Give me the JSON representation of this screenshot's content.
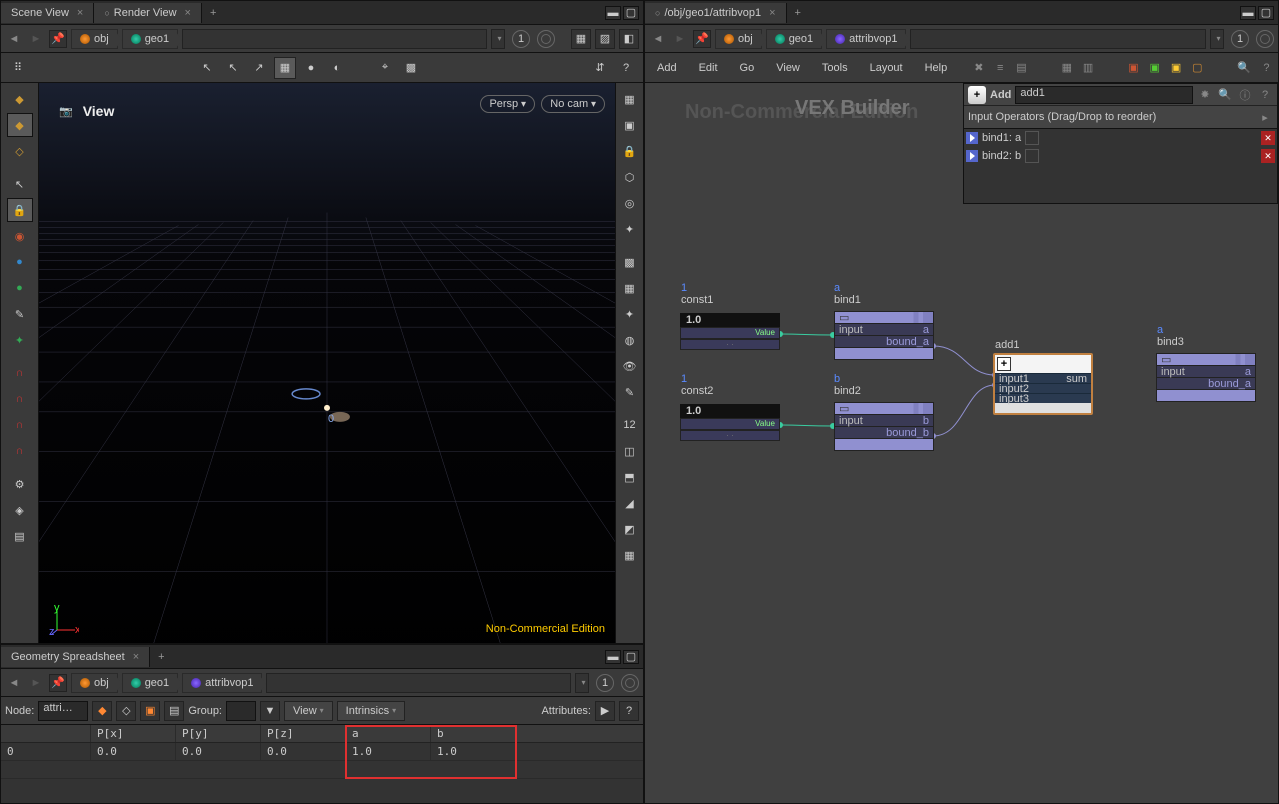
{
  "left_tabs": [
    "Scene View",
    "Render View"
  ],
  "right_tab": "/obj/geo1/attribvop1",
  "breadcrumbs": {
    "obj": "obj",
    "geo1": "geo1",
    "attribvop1": "attribvop1"
  },
  "circle_num": "1",
  "viewport": {
    "label": "View",
    "persp": "Persp",
    "nocam": "No cam",
    "nce": "Non-Commercial Edition",
    "ghost_nce": "Non-Commercial Edition"
  },
  "ne_menu": [
    "Add",
    "Edit",
    "Go",
    "View",
    "Tools",
    "Layout",
    "Help"
  ],
  "vex_label": "VEX Builder",
  "param": {
    "add_btn": "Add",
    "name": "add1",
    "inputs_header": "Input Operators (Drag/Drop to reorder)",
    "inputs": [
      "bind1: a",
      "bind2: b"
    ]
  },
  "nodes": {
    "const1": {
      "idx": "1",
      "name": "const1",
      "value": "1.0",
      "out": "Value"
    },
    "const2": {
      "idx": "1",
      "name": "const2",
      "value": "1.0",
      "out": "Value"
    },
    "bind1": {
      "idx": "a",
      "name": "bind1",
      "in": "input",
      "out": "bound_a"
    },
    "bind2": {
      "idx": "b",
      "name": "bind2",
      "in": "input",
      "out": "bound_b"
    },
    "add1": {
      "name": "add1",
      "ins": [
        "input1",
        "input2",
        "input3"
      ],
      "out": "sum"
    },
    "bind3": {
      "idx": "a",
      "name": "bind3",
      "in": "input",
      "out": "bound_a"
    }
  },
  "spreadsheet": {
    "tab": "Geometry Spreadsheet",
    "node_lbl": "Node:",
    "node_val": "attri…",
    "group_lbl": "Group:",
    "view_lbl": "View",
    "intrinsics_lbl": "Intrinsics",
    "attributes_lbl": "Attributes:",
    "headers": [
      "",
      "P[x]",
      "P[y]",
      "P[z]",
      "a",
      "b"
    ],
    "row_idx": "0",
    "row": [
      "0.0",
      "0.0",
      "0.0",
      "1.0",
      "1.0"
    ]
  }
}
